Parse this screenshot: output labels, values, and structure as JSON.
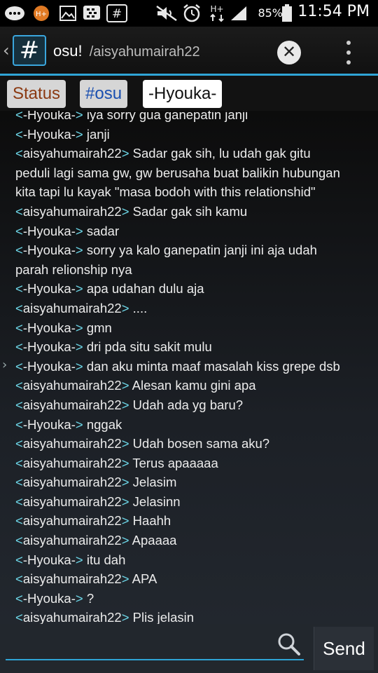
{
  "status_bar": {
    "battery_percent": "85%",
    "clock": "11:54 PM",
    "network_type": "H+"
  },
  "action_bar": {
    "app_icon_glyph": "#",
    "channel_name": "osu!",
    "channel_sub": "/aisyahumairah22"
  },
  "tabs": [
    {
      "label": "Status"
    },
    {
      "label": "#osu"
    },
    {
      "label": "-Hyouka-"
    }
  ],
  "messages": [
    {
      "nick": "-Hyouka-",
      "text": "iya sorry gua ganepatin janji"
    },
    {
      "nick": "-Hyouka-",
      "text": "janji"
    },
    {
      "nick": "aisyahumairah22",
      "text": "Sadar gak sih, lu udah gak gitu"
    },
    {
      "nick": "",
      "text": "peduli lagi sama gw, gw berusaha buat balikin hubungan"
    },
    {
      "nick": "",
      "text": "kita tapi lu kayak \"masa bodoh with this relationshid\""
    },
    {
      "nick": "aisyahumairah22",
      "text": "Sadar gak sih kamu"
    },
    {
      "nick": "-Hyouka-",
      "text": "sadar"
    },
    {
      "nick": "-Hyouka-",
      "text": "sorry ya kalo ganepatin janji ini aja udah"
    },
    {
      "nick": "",
      "text": "parah relionship nya"
    },
    {
      "nick": "-Hyouka-",
      "text": "apa udahan dulu aja"
    },
    {
      "nick": "aisyahumairah22",
      "text": "...."
    },
    {
      "nick": "-Hyouka-",
      "text": "gmn"
    },
    {
      "nick": "-Hyouka-",
      "text": "dri pda situ sakit mulu"
    },
    {
      "nick": "-Hyouka-",
      "text": "dan aku minta maaf masalah kiss grepe dsb"
    },
    {
      "nick": "aisyahumairah22",
      "text": "Alesan kamu gini apa"
    },
    {
      "nick": "aisyahumairah22",
      "text": "Udah ada yg baru?"
    },
    {
      "nick": "-Hyouka-",
      "text": "nggak"
    },
    {
      "nick": "aisyahumairah22",
      "text": "Udah bosen sama aku?"
    },
    {
      "nick": "aisyahumairah22",
      "text": "Terus apaaaaa"
    },
    {
      "nick": "aisyahumairah22",
      "text": "Jelasim"
    },
    {
      "nick": "aisyahumairah22",
      "text": "Jelasinn"
    },
    {
      "nick": "aisyahumairah22",
      "text": "Haahh"
    },
    {
      "nick": "aisyahumairah22",
      "text": "Apaaaa"
    },
    {
      "nick": "-Hyouka-",
      "text": "itu dah"
    },
    {
      "nick": "aisyahumairah22",
      "text": "APA"
    },
    {
      "nick": "-Hyouka-",
      "text": "?"
    },
    {
      "nick": "aisyahumairah22",
      "text": "Plis jelasin"
    }
  ],
  "input": {
    "value": "",
    "send_label": "Send"
  },
  "icons": {
    "close": "close-icon",
    "search": "search-icon",
    "overflow": "overflow-menu-icon",
    "back": "chevron-left-icon"
  },
  "colors": {
    "accent": "#2fa4d6",
    "nick_bracket": "#6cd5e6",
    "status_tab_text": "#8b3a12",
    "osu_tab_text": "#1a4fb0"
  }
}
